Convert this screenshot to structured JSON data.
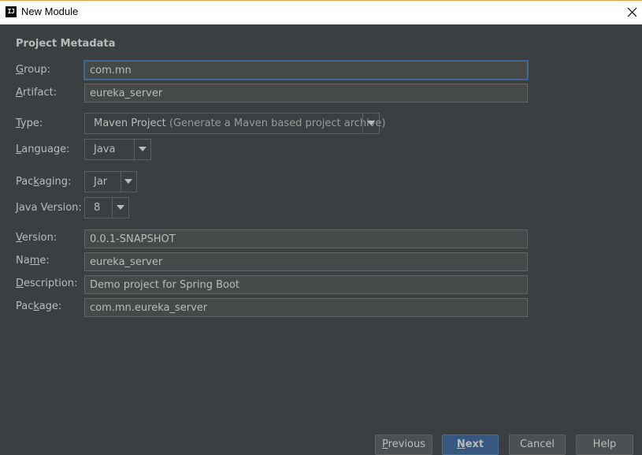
{
  "window": {
    "app_icon_text": "IJ",
    "title": "New Module"
  },
  "section_title": "Project Metadata",
  "fields": {
    "group": {
      "label_mn": "G",
      "label_rest": "roup:",
      "value": "com.mn"
    },
    "artifact": {
      "label_mn": "A",
      "label_rest": "rtifact:",
      "value": "eureka_server"
    },
    "type": {
      "label_mn": "T",
      "label_rest": "ype:",
      "value": "Maven Project",
      "hint": "(Generate a Maven based project archive)"
    },
    "language": {
      "label_mn": "L",
      "label_rest": "anguage:",
      "value": "Java"
    },
    "packaging": {
      "label_pre": "Pac",
      "label_mn": "k",
      "label_rest": "aging:",
      "value": "Jar"
    },
    "java_version": {
      "label_mn": "J",
      "label_rest": "ava Version:",
      "value": "8"
    },
    "version": {
      "label_mn": "V",
      "label_rest": "ersion:",
      "value": "0.0.1-SNAPSHOT"
    },
    "name": {
      "label_pre": "Na",
      "label_mn": "m",
      "label_rest": "e:",
      "value": "eureka_server"
    },
    "description": {
      "label_mn": "D",
      "label_rest": "escription:",
      "value": "Demo project for Spring Boot"
    },
    "package": {
      "label_pre": "Pac",
      "label_mn": "k",
      "label_rest": "age:",
      "value": "com.mn.eureka_server"
    }
  },
  "buttons": {
    "previous": {
      "mn": "P",
      "rest": "revious"
    },
    "next": {
      "mn": "N",
      "rest": "ext"
    },
    "cancel": "Cancel",
    "help": "Help"
  },
  "colors": {
    "background": "#3c3f41",
    "field_background": "#45494a",
    "focus_border": "#466d94",
    "default_button": "#365880",
    "title_accent": "#e8a040"
  },
  "icons": {
    "close": "close-icon",
    "app": "intellij-idea-icon",
    "dropdown": "chevron-down-icon"
  }
}
